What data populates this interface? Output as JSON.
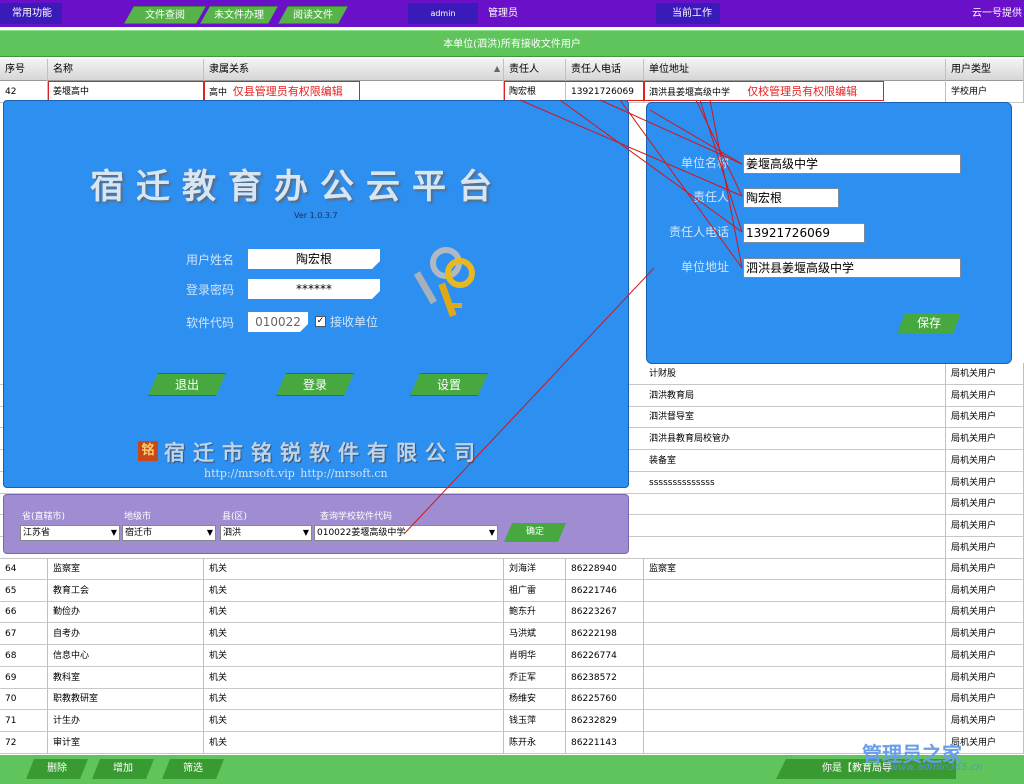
{
  "topnav": {
    "common_functions": "常用功能",
    "file_query": "文件查阅",
    "unfinished_files": "未文件办理",
    "read_files": "阅读文件",
    "admin_user": "admin",
    "admin_role": "管理员",
    "current_work": "当前工作",
    "provider": "云一号提供"
  },
  "subtitle": "本单位(泗洪)所有接收文件用户",
  "table": {
    "columns": [
      "序号",
      "名称",
      "隶属关系",
      "责任人",
      "责任人电话",
      "单位地址",
      "用户类型"
    ],
    "first_row": [
      "42",
      "姜堰高中",
      "高中",
      "陶宏根",
      "13921726069",
      "泗洪县姜堰高级中学",
      "学校用户"
    ],
    "note_county": "仅县管理员有权限编辑",
    "note_school": "仅校管理员有权限编辑",
    "partial_rows": [
      {
        "addr": "计财股",
        "type": "局机关用户"
      },
      {
        "addr": "泗洪教育局",
        "type": "局机关用户"
      },
      {
        "addr": "泗洪督导室",
        "type": "局机关用户"
      },
      {
        "addr": "泗洪县教育局校管办",
        "type": "局机关用户"
      },
      {
        "addr": "装备室",
        "type": "局机关用户"
      },
      {
        "addr": "ssssssssssssss",
        "type": "局机关用户"
      },
      {
        "addr": "",
        "type": "局机关用户"
      },
      {
        "addr": "",
        "type": "局机关用户"
      },
      {
        "addr": "",
        "type": "局机关用户"
      }
    ],
    "rows": [
      [
        "64",
        "监察室",
        "机关",
        "刘海洋",
        "86228940",
        "监察室",
        "局机关用户"
      ],
      [
        "65",
        "教育工会",
        "机关",
        "祖广雷",
        "86221746",
        "",
        "局机关用户"
      ],
      [
        "66",
        "勤俭办",
        "机关",
        "鲍东升",
        "86223267",
        "",
        "局机关用户"
      ],
      [
        "67",
        "自考办",
        "机关",
        "马洪斌",
        "86222198",
        "",
        "局机关用户"
      ],
      [
        "68",
        "信息中心",
        "机关",
        "肖明华",
        "86226774",
        "",
        "局机关用户"
      ],
      [
        "69",
        "教科室",
        "机关",
        "乔正军",
        "86238572",
        "",
        "局机关用户"
      ],
      [
        "70",
        "职教教研室",
        "机关",
        "杨维安",
        "86225760",
        "",
        "局机关用户"
      ],
      [
        "71",
        "计生办",
        "机关",
        "钱玉萍",
        "86232829",
        "",
        "局机关用户"
      ],
      [
        "72",
        "审计室",
        "机关",
        "陈开永",
        "86221143",
        "",
        "局机关用户"
      ]
    ]
  },
  "login": {
    "title": "宿迁教育办公云平台",
    "version": "Ver 1.0.3.7",
    "username_label": "用户姓名",
    "username_value": "陶宏根",
    "password_label": "登录密码",
    "password_value": "******",
    "code_label": "软件代码",
    "code_value": "010022",
    "receive_unit_label": "接收单位",
    "exit_label": "退出",
    "login_label": "登录",
    "settings_label": "设置",
    "seal": "铭",
    "company": "宿迁市铭锐软件有限公司",
    "urls": "http://mrsoft.vip   http://mrsoft.cn"
  },
  "selector": {
    "province_label": "省(直辖市)",
    "province_value": "江苏省",
    "city_label": "地级市",
    "city_value": "宿迁市",
    "county_label": "县(区)",
    "county_value": "泗洪",
    "school_label": "查询学校软件代码",
    "school_value": "010022姜堰高级中学",
    "confirm_label": "确定"
  },
  "edit": {
    "unit_name_label": "单位名称",
    "unit_name_value": "姜堰高级中学",
    "person_label": "责任人",
    "person_value": "陶宏根",
    "phone_label": "责任人电话",
    "phone_value": "13921726069",
    "address_label": "单位地址",
    "address_value": "泗洪县姜堰高级中学",
    "save_label": "保存"
  },
  "bottom": {
    "delete_label": "删除",
    "add_label": "增加",
    "filter_label": "筛选",
    "info_text": "你是【教育局导",
    "watermark": "管理员之家",
    "watermark_url": "www.admin365.cn"
  },
  "colors": {
    "nav_purple": "#6a10c8",
    "accent_green": "#5fc45b",
    "panel_blue": "#2d8ff0",
    "selector_purple": "#a08cd0",
    "note_red": "#e82020"
  }
}
